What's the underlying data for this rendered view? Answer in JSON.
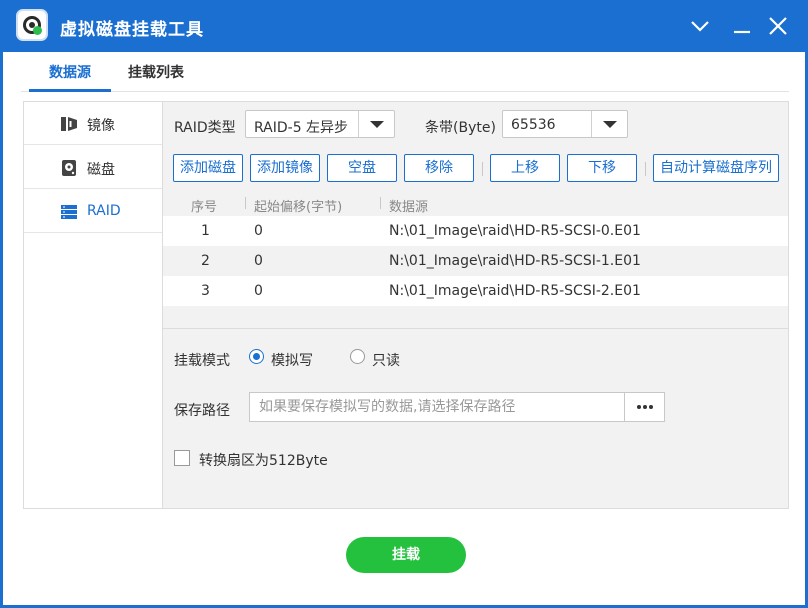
{
  "window": {
    "title": "虚拟磁盘挂载工具"
  },
  "tabs": [
    {
      "label": "数据源"
    },
    {
      "label": "挂载列表"
    }
  ],
  "sidebar": {
    "items": [
      {
        "label": "镜像"
      },
      {
        "label": "磁盘"
      },
      {
        "label": "RAID"
      }
    ]
  },
  "raid": {
    "type_label": "RAID类型",
    "type_value": "RAID-5 左异步",
    "stripe_label": "条带(Byte)",
    "stripe_value": "65536"
  },
  "toolbar": {
    "add_disk": "添加磁盘",
    "add_image": "添加镜像",
    "empty_disk": "空盘",
    "remove": "移除",
    "move_up": "上移",
    "move_down": "下移",
    "auto_order": "自动计算磁盘序列"
  },
  "table": {
    "headers": [
      "序号",
      "起始偏移(字节)",
      "数据源"
    ],
    "rows": [
      {
        "index": "1",
        "offset": "0",
        "source": "N:\\01_Image\\raid\\HD-R5-SCSI-0.E01"
      },
      {
        "index": "2",
        "offset": "0",
        "source": "N:\\01_Image\\raid\\HD-R5-SCSI-1.E01"
      },
      {
        "index": "3",
        "offset": "0",
        "source": "N:\\01_Image\\raid\\HD-R5-SCSI-2.E01"
      }
    ]
  },
  "options": {
    "mount_mode_label": "挂载模式",
    "mode_simulated_write": "模拟写",
    "mode_read_only": "只读",
    "selected_mode": "模拟写",
    "save_path_label": "保存路径",
    "save_path_placeholder": "如果要保存模拟写的数据,请选择保存路径",
    "convert_sector_label": "转换扇区为512Byte",
    "convert_sector_checked": false
  },
  "mount_button": "挂载",
  "colors": {
    "accent": "#1a6fd1",
    "primary_action": "#24c13f"
  }
}
